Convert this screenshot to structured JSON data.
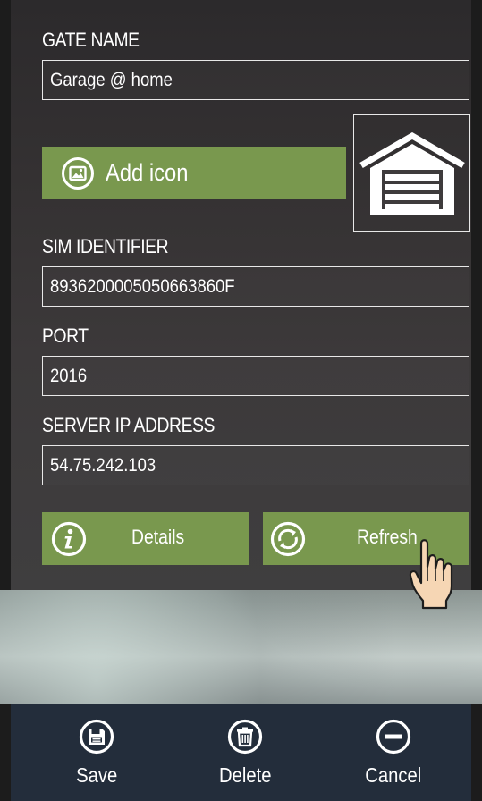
{
  "form": {
    "gate_name_label": "GATE NAME",
    "gate_name_value": "Garage @ home",
    "add_icon_label": "Add icon",
    "sim_identifier_label": "SIM IDENTIFIER",
    "sim_identifier_value": "8936200005050663860F",
    "port_label": "PORT",
    "port_value": "2016",
    "server_ip_label": "SERVER IP ADDRESS",
    "server_ip_value": "54.75.242.103"
  },
  "actions": {
    "details_label": "Details",
    "refresh_label": "Refresh"
  },
  "bottom_bar": {
    "save_label": "Save",
    "delete_label": "Delete",
    "cancel_label": "Cancel"
  },
  "icons": {
    "add_icon": "image-icon",
    "gate_icon": "garage-icon",
    "details": "info-icon",
    "refresh": "refresh-icon",
    "pointer": "hand-pointer-icon",
    "save": "floppy-disk-icon",
    "delete": "trash-icon",
    "cancel": "minus-circle-icon"
  },
  "colors": {
    "accent_green": "#79984e",
    "bottom_bar": "#232d3b"
  }
}
